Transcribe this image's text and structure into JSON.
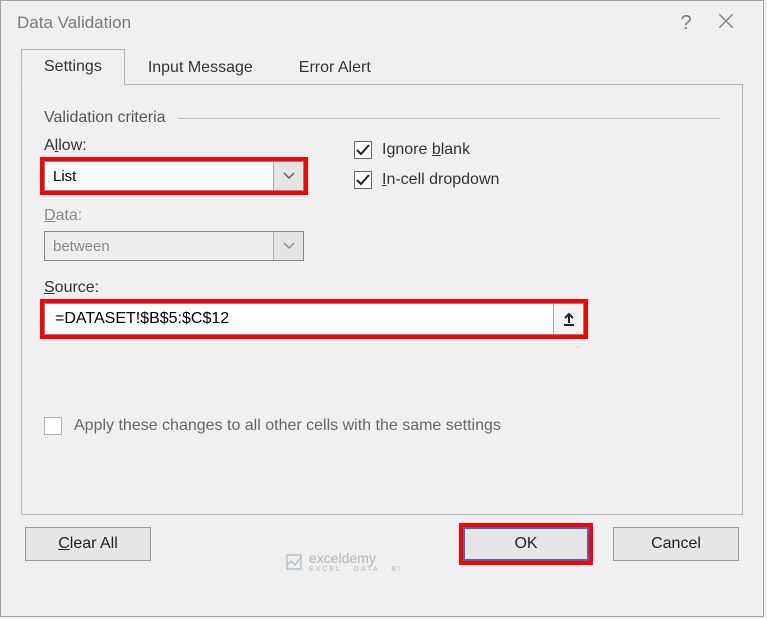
{
  "dialog": {
    "title": "Data Validation",
    "help": "?",
    "close_name": "close-icon"
  },
  "tabs": {
    "settings": "Settings",
    "input_message": "Input Message",
    "error_alert": "Error Alert"
  },
  "criteria": {
    "legend": "Validation criteria",
    "allow_label_pre": "A",
    "allow_label_u": "l",
    "allow_label_post": "low:",
    "allow_value": "List",
    "data_label_pre": "",
    "data_label_u": "D",
    "data_label_post": "ata:",
    "data_value": "between",
    "source_label_pre": "",
    "source_label_u": "S",
    "source_label_post": "ource:",
    "source_value": "=DATASET!$B$5:$C$12"
  },
  "options": {
    "ignore_blank_pre": "Ignore ",
    "ignore_blank_u": "b",
    "ignore_blank_post": "lank",
    "ignore_blank_checked": true,
    "incell_pre": "",
    "incell_u": "I",
    "incell_post": "n-cell dropdown",
    "incell_checked": true
  },
  "apply": {
    "label_pre": "Apply these changes to all other cells with the same settings",
    "checked": false
  },
  "buttons": {
    "clear_pre": "",
    "clear_u": "C",
    "clear_post": "lear All",
    "ok": "OK",
    "cancel": "Cancel"
  },
  "watermark": {
    "main": "exceldemy",
    "sub": "EXCEL · DATA · BI"
  }
}
